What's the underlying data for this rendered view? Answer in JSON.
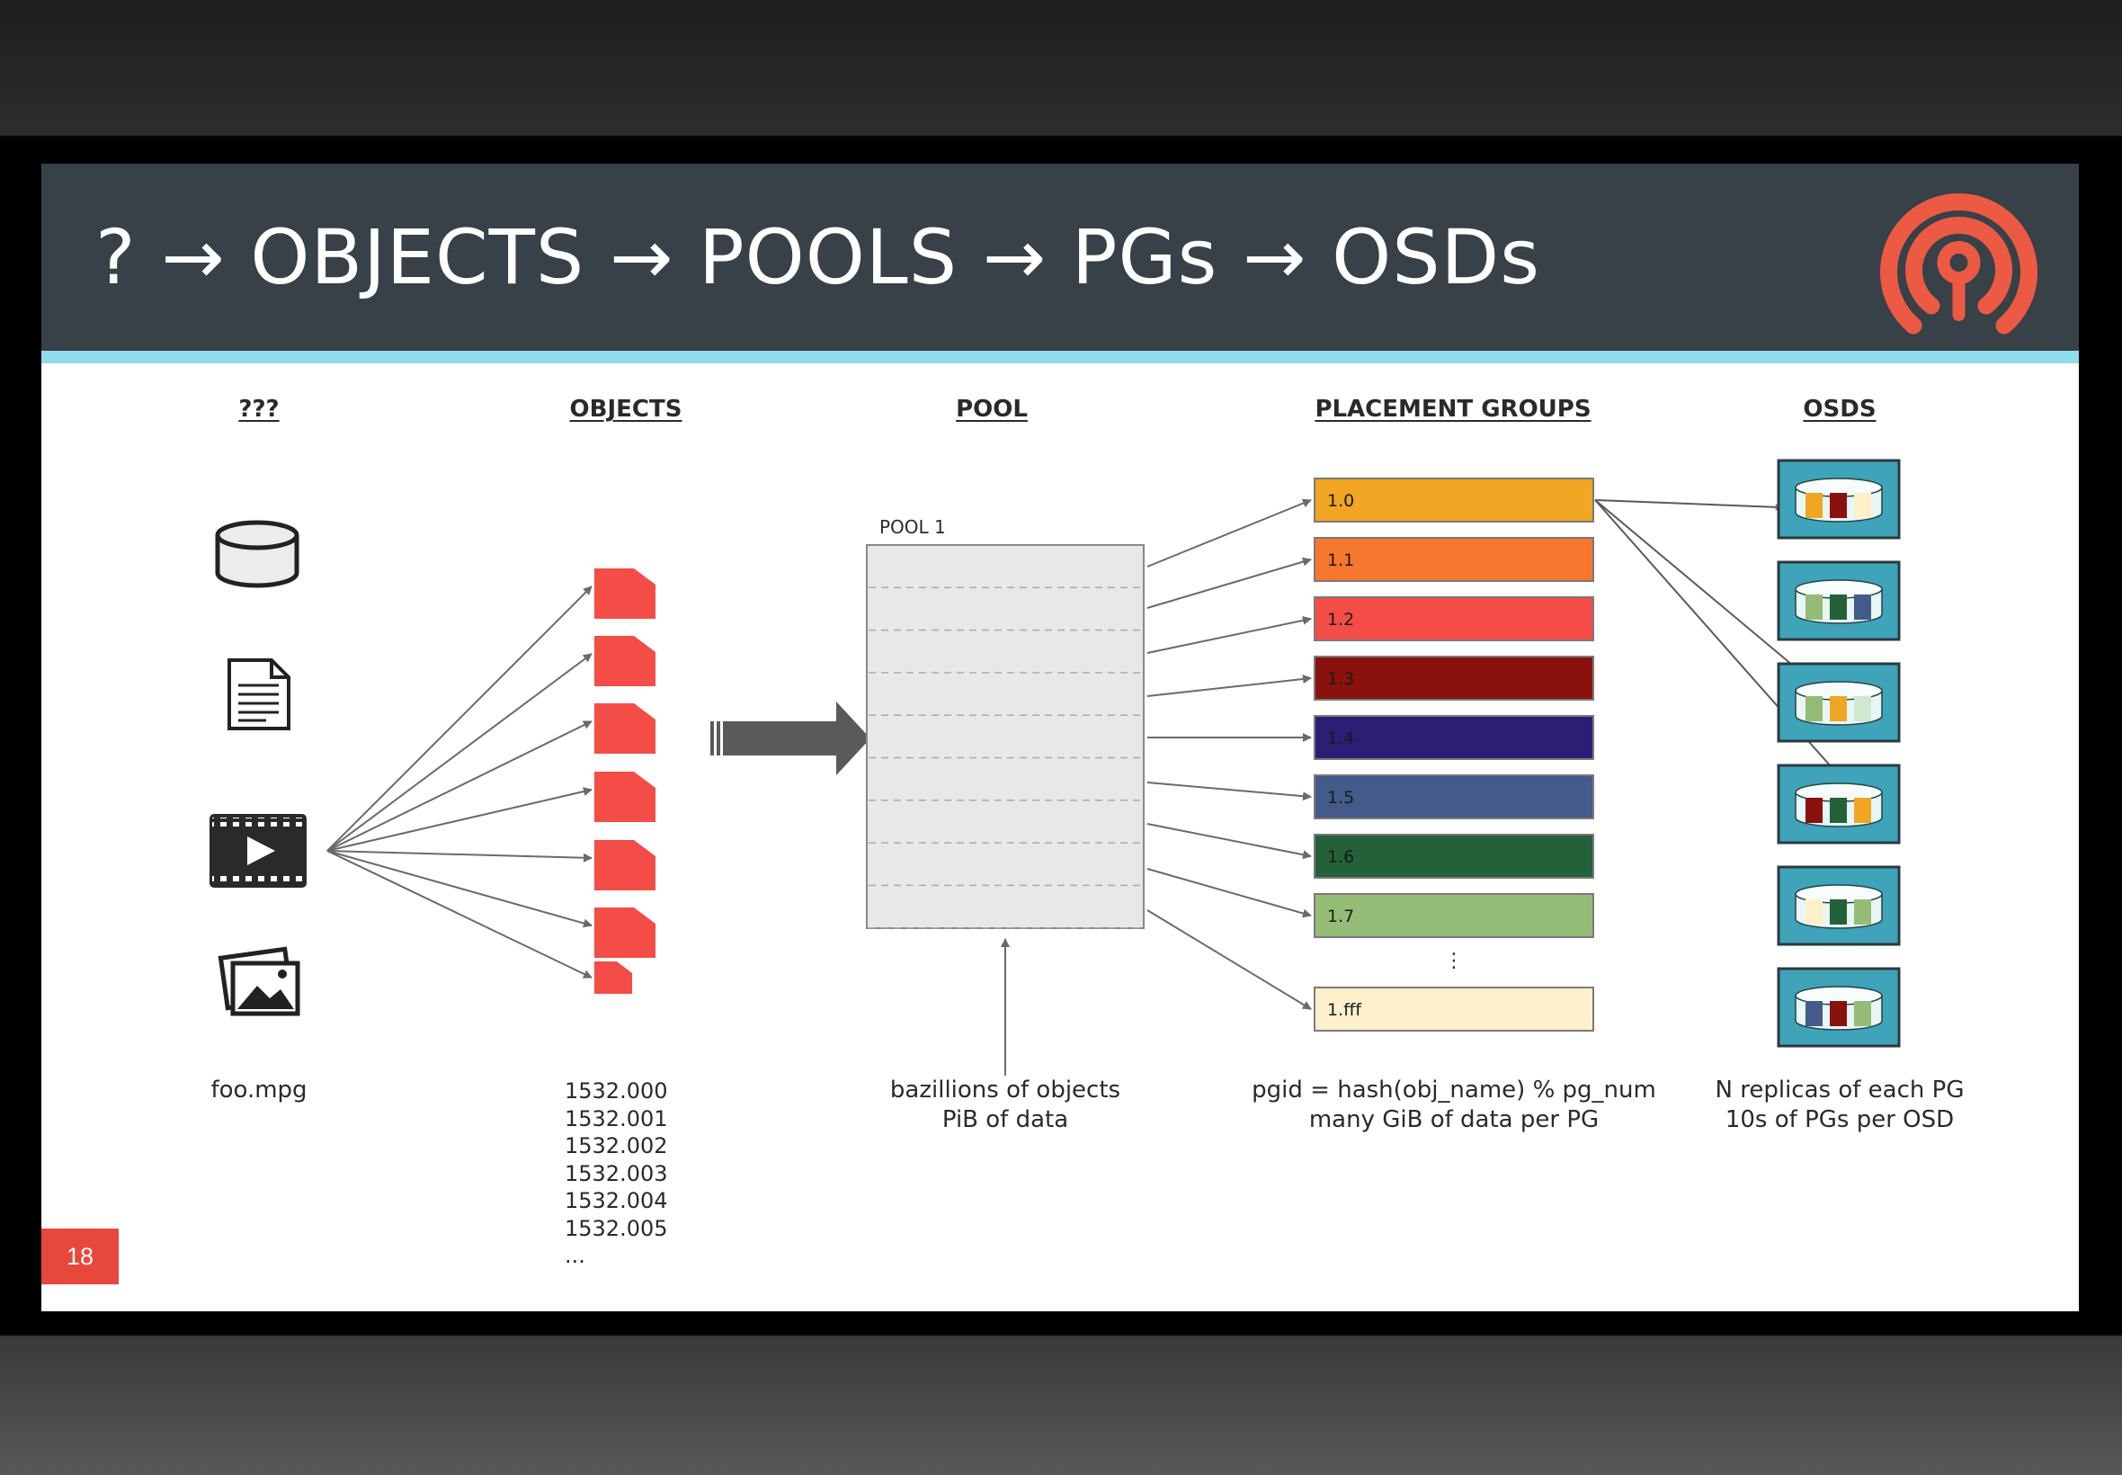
{
  "slide": {
    "title": "? → OBJECTS → POOLS → PGs → OSDs",
    "page_number": "18"
  },
  "columns": {
    "unknown": {
      "heading": "???",
      "caption": "foo.mpg",
      "icons": [
        "database-icon",
        "document-icon",
        "video-icon",
        "images-icon"
      ]
    },
    "objects": {
      "heading": "OBJECTS",
      "ids": [
        "1532.000",
        "1532.001",
        "1532.002",
        "1532.003",
        "1532.004",
        "1532.005",
        "..."
      ]
    },
    "pool": {
      "heading": "POOL",
      "pool_label": "POOL 1",
      "caption_line1": "bazillions of objects",
      "caption_line2": "PiB of data"
    },
    "placement_groups": {
      "heading": "PLACEMENT GROUPS",
      "items": [
        {
          "label": "1.0",
          "color": "#f0a623"
        },
        {
          "label": "1.1",
          "color": "#f8772e"
        },
        {
          "label": "1.2",
          "color": "#f44c46"
        },
        {
          "label": "1.3",
          "color": "#8b110c"
        },
        {
          "label": "1.4",
          "color": "#2a1f74"
        },
        {
          "label": "1.5",
          "color": "#435a8b"
        },
        {
          "label": "1.6",
          "color": "#246139"
        },
        {
          "label": "1.7",
          "color": "#94bc76"
        },
        {
          "label": "1.fff",
          "color": "#fff0cc"
        }
      ],
      "ellipsis": "⋮",
      "caption_line1": "pgid = hash(obj_name) % pg_num",
      "caption_line2": "many GiB of data per PG"
    },
    "osds": {
      "heading": "OSDS",
      "caption_line1": "N replicas of each PG",
      "caption_line2": "10s of PGs per OSD",
      "disks": [
        [
          "#f0a623",
          "#8b110c",
          "#fff0cc"
        ],
        [
          "#94bc76",
          "#246139",
          "#435a8b"
        ],
        [
          "#94bc76",
          "#f0a623",
          "#cfe8cf"
        ],
        [
          "#8b110c",
          "#246139",
          "#f0a623"
        ],
        [
          "#fff0cc",
          "#246139",
          "#94bc76"
        ],
        [
          "#435a8b",
          "#8b110c",
          "#94bc76"
        ]
      ]
    }
  },
  "colors": {
    "title_bar": "#374147",
    "accent_stripe": "#8fdcec",
    "object_red": "#f44c46",
    "osd_teal": "#3fa3b9",
    "logo": "#ec5a44"
  }
}
